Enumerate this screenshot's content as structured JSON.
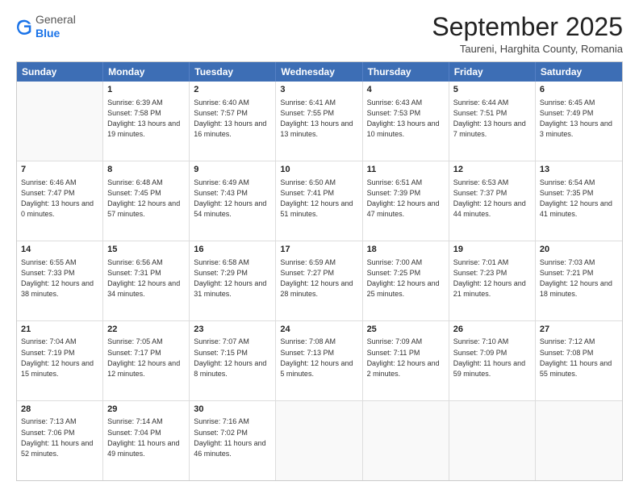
{
  "header": {
    "logo": {
      "general": "General",
      "blue": "Blue"
    },
    "title": "September 2025",
    "location": "Taureni, Harghita County, Romania"
  },
  "calendar": {
    "days_of_week": [
      "Sunday",
      "Monday",
      "Tuesday",
      "Wednesday",
      "Thursday",
      "Friday",
      "Saturday"
    ],
    "weeks": [
      [
        {
          "day": "",
          "empty": true
        },
        {
          "day": "1",
          "sunrise": "Sunrise: 6:39 AM",
          "sunset": "Sunset: 7:58 PM",
          "daylight": "Daylight: 13 hours and 19 minutes."
        },
        {
          "day": "2",
          "sunrise": "Sunrise: 6:40 AM",
          "sunset": "Sunset: 7:57 PM",
          "daylight": "Daylight: 13 hours and 16 minutes."
        },
        {
          "day": "3",
          "sunrise": "Sunrise: 6:41 AM",
          "sunset": "Sunset: 7:55 PM",
          "daylight": "Daylight: 13 hours and 13 minutes."
        },
        {
          "day": "4",
          "sunrise": "Sunrise: 6:43 AM",
          "sunset": "Sunset: 7:53 PM",
          "daylight": "Daylight: 13 hours and 10 minutes."
        },
        {
          "day": "5",
          "sunrise": "Sunrise: 6:44 AM",
          "sunset": "Sunset: 7:51 PM",
          "daylight": "Daylight: 13 hours and 7 minutes."
        },
        {
          "day": "6",
          "sunrise": "Sunrise: 6:45 AM",
          "sunset": "Sunset: 7:49 PM",
          "daylight": "Daylight: 13 hours and 3 minutes."
        }
      ],
      [
        {
          "day": "7",
          "sunrise": "Sunrise: 6:46 AM",
          "sunset": "Sunset: 7:47 PM",
          "daylight": "Daylight: 13 hours and 0 minutes."
        },
        {
          "day": "8",
          "sunrise": "Sunrise: 6:48 AM",
          "sunset": "Sunset: 7:45 PM",
          "daylight": "Daylight: 12 hours and 57 minutes."
        },
        {
          "day": "9",
          "sunrise": "Sunrise: 6:49 AM",
          "sunset": "Sunset: 7:43 PM",
          "daylight": "Daylight: 12 hours and 54 minutes."
        },
        {
          "day": "10",
          "sunrise": "Sunrise: 6:50 AM",
          "sunset": "Sunset: 7:41 PM",
          "daylight": "Daylight: 12 hours and 51 minutes."
        },
        {
          "day": "11",
          "sunrise": "Sunrise: 6:51 AM",
          "sunset": "Sunset: 7:39 PM",
          "daylight": "Daylight: 12 hours and 47 minutes."
        },
        {
          "day": "12",
          "sunrise": "Sunrise: 6:53 AM",
          "sunset": "Sunset: 7:37 PM",
          "daylight": "Daylight: 12 hours and 44 minutes."
        },
        {
          "day": "13",
          "sunrise": "Sunrise: 6:54 AM",
          "sunset": "Sunset: 7:35 PM",
          "daylight": "Daylight: 12 hours and 41 minutes."
        }
      ],
      [
        {
          "day": "14",
          "sunrise": "Sunrise: 6:55 AM",
          "sunset": "Sunset: 7:33 PM",
          "daylight": "Daylight: 12 hours and 38 minutes."
        },
        {
          "day": "15",
          "sunrise": "Sunrise: 6:56 AM",
          "sunset": "Sunset: 7:31 PM",
          "daylight": "Daylight: 12 hours and 34 minutes."
        },
        {
          "day": "16",
          "sunrise": "Sunrise: 6:58 AM",
          "sunset": "Sunset: 7:29 PM",
          "daylight": "Daylight: 12 hours and 31 minutes."
        },
        {
          "day": "17",
          "sunrise": "Sunrise: 6:59 AM",
          "sunset": "Sunset: 7:27 PM",
          "daylight": "Daylight: 12 hours and 28 minutes."
        },
        {
          "day": "18",
          "sunrise": "Sunrise: 7:00 AM",
          "sunset": "Sunset: 7:25 PM",
          "daylight": "Daylight: 12 hours and 25 minutes."
        },
        {
          "day": "19",
          "sunrise": "Sunrise: 7:01 AM",
          "sunset": "Sunset: 7:23 PM",
          "daylight": "Daylight: 12 hours and 21 minutes."
        },
        {
          "day": "20",
          "sunrise": "Sunrise: 7:03 AM",
          "sunset": "Sunset: 7:21 PM",
          "daylight": "Daylight: 12 hours and 18 minutes."
        }
      ],
      [
        {
          "day": "21",
          "sunrise": "Sunrise: 7:04 AM",
          "sunset": "Sunset: 7:19 PM",
          "daylight": "Daylight: 12 hours and 15 minutes."
        },
        {
          "day": "22",
          "sunrise": "Sunrise: 7:05 AM",
          "sunset": "Sunset: 7:17 PM",
          "daylight": "Daylight: 12 hours and 12 minutes."
        },
        {
          "day": "23",
          "sunrise": "Sunrise: 7:07 AM",
          "sunset": "Sunset: 7:15 PM",
          "daylight": "Daylight: 12 hours and 8 minutes."
        },
        {
          "day": "24",
          "sunrise": "Sunrise: 7:08 AM",
          "sunset": "Sunset: 7:13 PM",
          "daylight": "Daylight: 12 hours and 5 minutes."
        },
        {
          "day": "25",
          "sunrise": "Sunrise: 7:09 AM",
          "sunset": "Sunset: 7:11 PM",
          "daylight": "Daylight: 12 hours and 2 minutes."
        },
        {
          "day": "26",
          "sunrise": "Sunrise: 7:10 AM",
          "sunset": "Sunset: 7:09 PM",
          "daylight": "Daylight: 11 hours and 59 minutes."
        },
        {
          "day": "27",
          "sunrise": "Sunrise: 7:12 AM",
          "sunset": "Sunset: 7:08 PM",
          "daylight": "Daylight: 11 hours and 55 minutes."
        }
      ],
      [
        {
          "day": "28",
          "sunrise": "Sunrise: 7:13 AM",
          "sunset": "Sunset: 7:06 PM",
          "daylight": "Daylight: 11 hours and 52 minutes."
        },
        {
          "day": "29",
          "sunrise": "Sunrise: 7:14 AM",
          "sunset": "Sunset: 7:04 PM",
          "daylight": "Daylight: 11 hours and 49 minutes."
        },
        {
          "day": "30",
          "sunrise": "Sunrise: 7:16 AM",
          "sunset": "Sunset: 7:02 PM",
          "daylight": "Daylight: 11 hours and 46 minutes."
        },
        {
          "day": "",
          "empty": true
        },
        {
          "day": "",
          "empty": true
        },
        {
          "day": "",
          "empty": true
        },
        {
          "day": "",
          "empty": true
        }
      ]
    ]
  }
}
